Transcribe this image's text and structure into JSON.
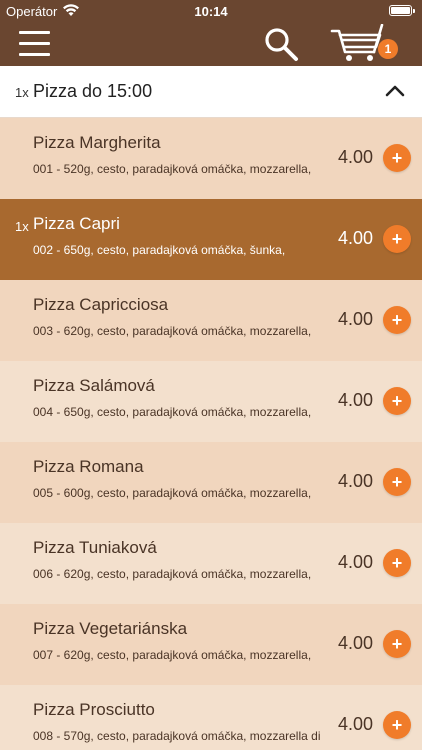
{
  "status_bar": {
    "carrier": "Operátor",
    "time": "10:14"
  },
  "nav": {
    "menu_icon": "hamburger-menu-icon",
    "search_icon": "search-icon",
    "cart_icon": "cart-icon",
    "cart_badge": "1"
  },
  "section": {
    "quantity": "1x",
    "title": "Pizza do 15:00",
    "chevron_icon": "chevron-up-icon"
  },
  "items": [
    {
      "quantity": "",
      "name": "Pizza Margherita",
      "description": "001 - 520g, cesto, paradajková omáčka, mozzarella,",
      "price": "4.00",
      "add_label": "+"
    },
    {
      "quantity": "1x",
      "name": "Pizza Capri",
      "description": "002 - 650g, cesto, paradajková omáčka, šunka,",
      "price": "4.00",
      "add_label": "+"
    },
    {
      "quantity": "",
      "name": "Pizza Capricciosa",
      "description": "003 - 620g, cesto, paradajková omáčka, mozzarella,",
      "price": "4.00",
      "add_label": "+"
    },
    {
      "quantity": "",
      "name": "Pizza Salámová",
      "description": "004 - 650g, cesto, paradajková omáčka, mozzarella,",
      "price": "4.00",
      "add_label": "+"
    },
    {
      "quantity": "",
      "name": "Pizza Romana",
      "description": "005 - 600g, cesto, paradajková omáčka, mozzarella,",
      "price": "4.00",
      "add_label": "+"
    },
    {
      "quantity": "",
      "name": "Pizza Tuniaková",
      "description": "006 - 620g, cesto, paradajková omáčka, mozzarella,",
      "price": "4.00",
      "add_label": "+"
    },
    {
      "quantity": "",
      "name": "Pizza Vegetariánska",
      "description": "007 - 620g, cesto, paradajková omáčka, mozzarella,",
      "price": "4.00",
      "add_label": "+"
    },
    {
      "quantity": "",
      "name": "Pizza Prosciutto",
      "description": "008 - 570g, cesto, paradajková omáčka, mozzarella di",
      "price": "4.00",
      "add_label": "+"
    }
  ],
  "colors": {
    "nav_background": "#6a4630",
    "row_odd": "#f1d6be",
    "row_even": "#f3e0cd",
    "row_selected": "#a8692f",
    "accent": "#f07c2a"
  }
}
